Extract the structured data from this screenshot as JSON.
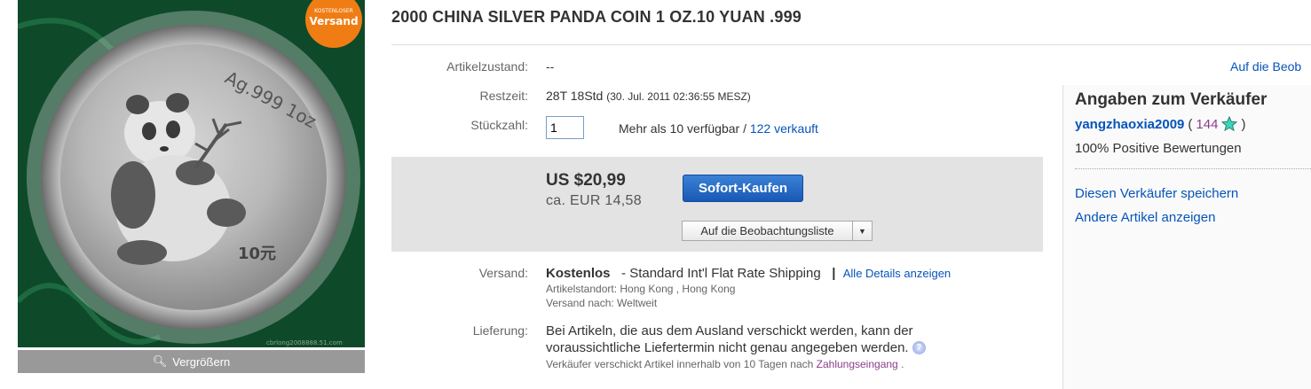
{
  "listing": {
    "title": "2000 CHINA SILVER PANDA COIN 1 OZ.10 YUAN .999"
  },
  "photo": {
    "badge_line1": "KOSTENLOSER",
    "badge_line2": "Versand",
    "coin_text": "Ag.999 1oz",
    "coin_denom": "10元",
    "watermark": "cbrlong2008888.51.com",
    "enlarge_label": "Vergrößern"
  },
  "details": {
    "condition_label": "Artikelzustand:",
    "condition_value": "--",
    "time_label": "Restzeit:",
    "time_value": "28T 18Std",
    "time_end": "(30. Jul. 2011 02:36:55 MESZ)",
    "qty_label": "Stückzahl:",
    "qty_value": "1",
    "availability": "Mehr als 10 verfügbar /",
    "sold_link": "122 verkauft"
  },
  "buy": {
    "price": "US $20,99",
    "price_eur": "ca. EUR 14,58",
    "buy_now": "Sofort-Kaufen",
    "watchlist": "Auf die Beobachtungsliste"
  },
  "shipping": {
    "label": "Versand:",
    "cost": "Kostenlos",
    "method": "- Standard Int'l Flat Rate Shipping",
    "separator": "|",
    "all_details": "Alle Details anzeigen",
    "location": "Artikelstandort: Hong Kong , Hong Kong",
    "ships_to": "Versand nach: Weltweit"
  },
  "delivery": {
    "label": "Lieferung:",
    "line1": "Bei Artikeln, die aus dem Ausland verschickt werden, kann der",
    "line2": "voraussichtliche Liefertermin nicht genau angegeben werden.",
    "handling": "Verkäufer verschickt Artikel innerhalb von 10 Tagen nach",
    "handling_link": "Zahlungseingang",
    "handling_end": "."
  },
  "seller": {
    "heading": "Angaben zum Verkäufer",
    "username": "yangzhaoxia2009",
    "paren_open": "(",
    "score": "144",
    "paren_close": ")",
    "positive": "100% Positive Bewertungen",
    "save_link": "Diesen Verkäufer speichern",
    "other_link": "Andere Artikel anzeigen"
  },
  "top_right_link": "Auf die Beob",
  "colors": {
    "link": "#0654ba",
    "buy_button": "#1858b5",
    "buy_box_bg": "#e3e3e3",
    "badge": "#f07d14",
    "feedback_score": "#8a3e8a"
  }
}
